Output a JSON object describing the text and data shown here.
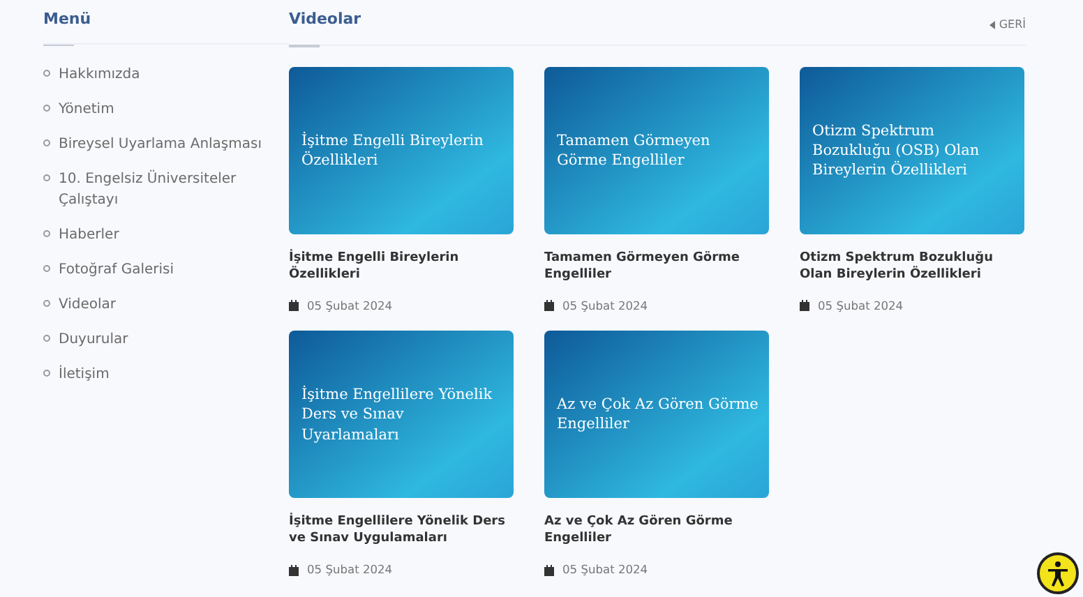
{
  "sidebar": {
    "title": "Menü",
    "items": [
      {
        "label": "Hakkımızda"
      },
      {
        "label": "Yönetim"
      },
      {
        "label": "Bireysel Uyarlama Anlaşması"
      },
      {
        "label": "10. Engelsiz Üniversiteler Çalıştayı"
      },
      {
        "label": "Haberler"
      },
      {
        "label": "Fotoğraf Galerisi"
      },
      {
        "label": "Videolar"
      },
      {
        "label": "Duyurular"
      },
      {
        "label": "İletişim"
      }
    ]
  },
  "content": {
    "title": "Videolar",
    "back": "GERİ",
    "videos": [
      {
        "thumb_text": "İşitme Engelli Bireylerin Özellikleri",
        "title": "İşitme Engelli Bireylerin Özellikleri",
        "date": "05 Şubat 2024"
      },
      {
        "thumb_text": "Tamamen Görmeyen Görme Engelliler",
        "title": "Tamamen Görmeyen Görme Engelliler",
        "date": "05 Şubat 2024"
      },
      {
        "thumb_text": "Otizm Spektrum Bozukluğu (OSB) Olan Bireylerin Özellikleri",
        "title": "Otizm Spektrum Bozukluğu Olan Bireylerin Özellikleri",
        "date": "05 Şubat 2024"
      },
      {
        "thumb_text": "İşitme Engellilere Yönelik Ders ve Sınav Uyarlamaları",
        "title": "İşitme Engellilere Yönelik Ders ve Sınav Uygulamaları",
        "date": "05 Şubat 2024"
      },
      {
        "thumb_text": "Az ve Çok Az Gören Görme Engelliler",
        "title": "Az ve Çok Az Gören Görme Engelliler",
        "date": "05 Şubat 2024"
      }
    ]
  }
}
